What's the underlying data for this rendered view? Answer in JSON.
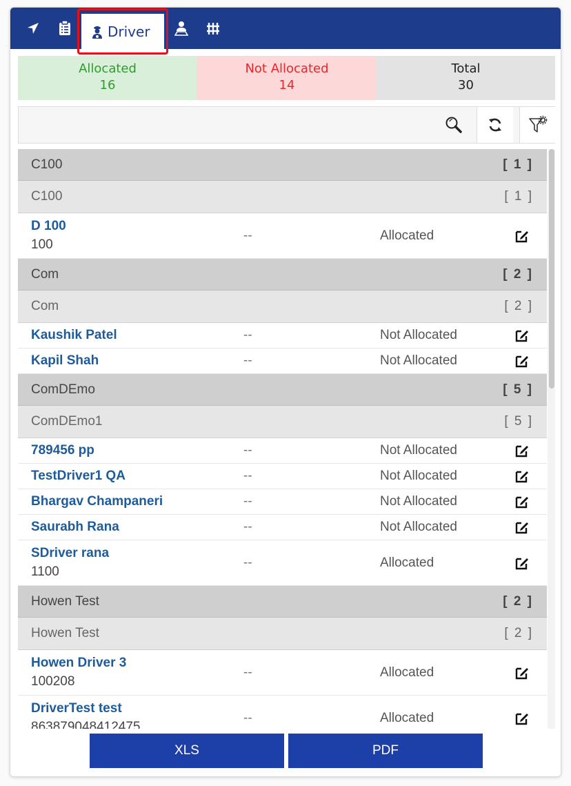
{
  "toolbar": {
    "tabs": [
      {
        "icon": "navigation-arrow-icon"
      },
      {
        "icon": "clipboard-icon"
      },
      {
        "icon": "driver-icon",
        "label": "Driver",
        "active": true
      },
      {
        "icon": "driver-location-icon"
      },
      {
        "icon": "fence-icon"
      }
    ]
  },
  "summary": {
    "allocated_label": "Allocated",
    "allocated_count": "16",
    "not_allocated_label": "Not Allocated",
    "not_allocated_count": "14",
    "total_label": "Total",
    "total_count": "30"
  },
  "search": {
    "placeholder": "",
    "value": ""
  },
  "groups": [
    {
      "name": "C100",
      "count": "[ 1 ]",
      "subgroup": {
        "name": "C100",
        "count": "[ 1 ]"
      },
      "drivers": [
        {
          "name": "D 100",
          "sub": "100",
          "vehicle": "--",
          "status": "Allocated"
        }
      ]
    },
    {
      "name": "Com",
      "count": "[ 2 ]",
      "subgroup": {
        "name": "Com",
        "count": "[ 2 ]"
      },
      "drivers": [
        {
          "name": "Kaushik Patel",
          "sub": "",
          "vehicle": "--",
          "status": "Not Allocated"
        },
        {
          "name": "Kapil Shah",
          "sub": "",
          "vehicle": "--",
          "status": "Not Allocated"
        }
      ]
    },
    {
      "name": "ComDEmo",
      "count": "[ 5 ]",
      "subgroup": {
        "name": "ComDEmo1",
        "count": "[ 5 ]"
      },
      "drivers": [
        {
          "name": "789456 pp",
          "sub": "",
          "vehicle": "--",
          "status": "Not Allocated"
        },
        {
          "name": "TestDriver1 QA",
          "sub": "",
          "vehicle": "--",
          "status": "Not Allocated"
        },
        {
          "name": "Bhargav Champaneri",
          "sub": "",
          "vehicle": "--",
          "status": "Not Allocated"
        },
        {
          "name": "Saurabh Rana",
          "sub": "",
          "vehicle": "--",
          "status": "Not Allocated"
        },
        {
          "name": "SDriver rana",
          "sub": "1100",
          "vehicle": "--",
          "status": "Allocated"
        }
      ]
    },
    {
      "name": "Howen Test",
      "count": "[ 2 ]",
      "subgroup": {
        "name": "Howen Test",
        "count": "[ 2 ]"
      },
      "drivers": [
        {
          "name": "Howen Driver 3",
          "sub": "100208",
          "vehicle": "--",
          "status": "Allocated"
        },
        {
          "name": "DriverTest test",
          "sub": "863879048412475",
          "vehicle": "--",
          "status": "Allocated"
        }
      ]
    }
  ],
  "footer": {
    "xls_label": "XLS",
    "pdf_label": "PDF"
  },
  "colors": {
    "brand": "#1d3c8c",
    "button": "#1d3fa8",
    "allocated": "#2e9b2e",
    "not_allocated": "#e8262b",
    "link": "#1e5b9b",
    "highlight": "#e3101c"
  }
}
